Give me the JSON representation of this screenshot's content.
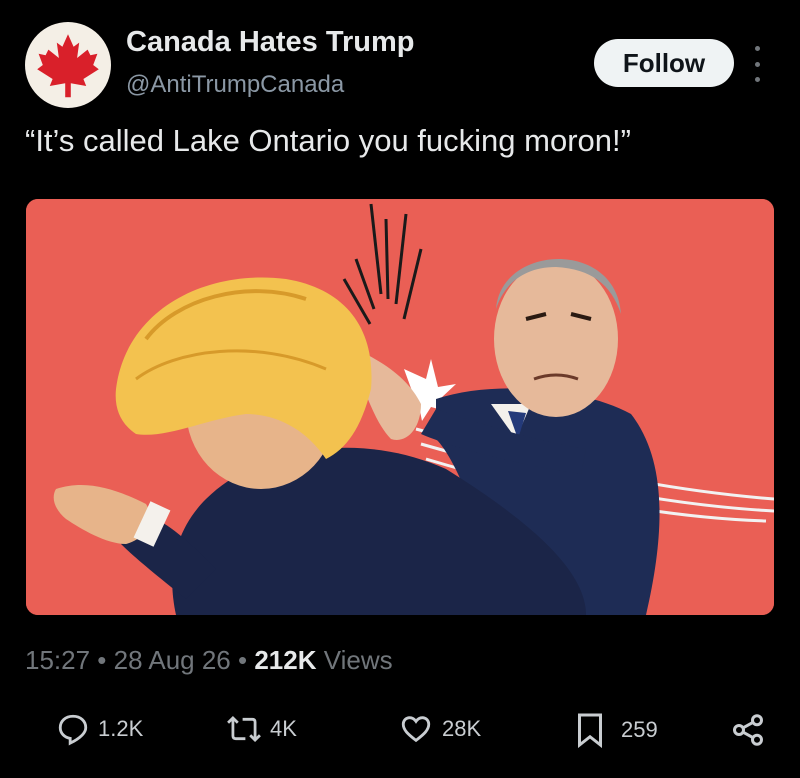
{
  "author": {
    "name": "Canada Hates Trump",
    "handle": "@AntiTrumpCanada",
    "follow_label": "Follow"
  },
  "tweet": {
    "text": "“It’s called Lake Ontario you fucking moron!”"
  },
  "meta": {
    "time": "15:27",
    "sep1": " • ",
    "date": "28 Aug 26",
    "sep2": " • ",
    "views_count": "212K",
    "views_label": " Views"
  },
  "actions": {
    "replies": "1.2K",
    "reposts": "4K",
    "likes": "28K",
    "bookmarks": "259"
  },
  "colors": {
    "background": "#000000",
    "media_background": "#ea5f55",
    "follow_bg": "#eff3f4",
    "muted_text": "#71767b"
  }
}
